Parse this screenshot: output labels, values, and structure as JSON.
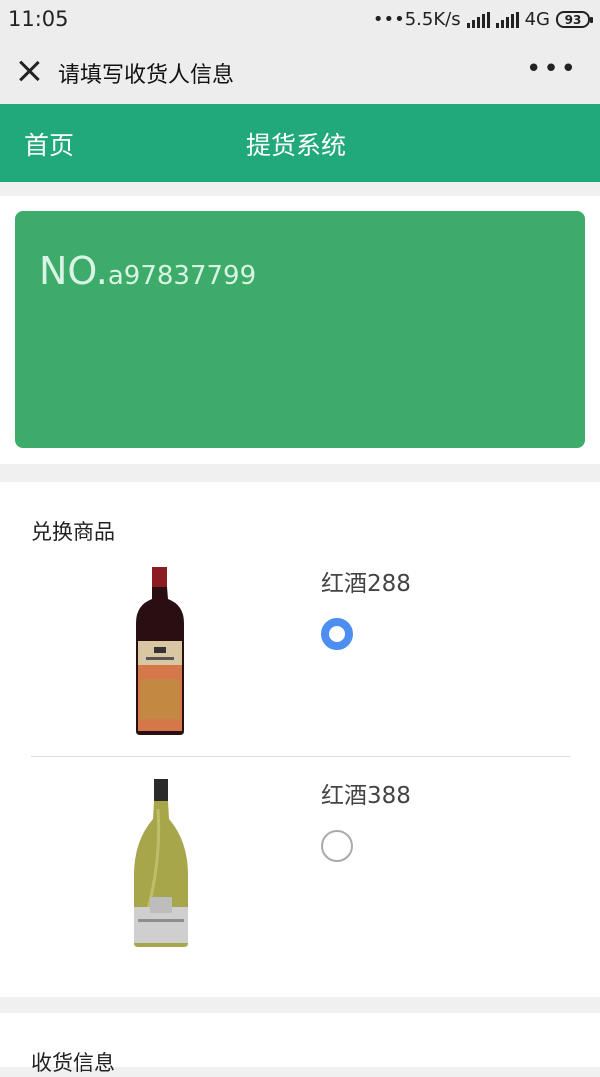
{
  "status_bar": {
    "time": "11:05",
    "network_speed": "•••5.5K/s",
    "network_type": "4G",
    "battery": "93"
  },
  "title_bar": {
    "close_icon": "close-icon",
    "title": "请填写收货人信息",
    "more_icon": "more-icon",
    "more_label": "•••"
  },
  "nav": {
    "home": "首页",
    "system": "提货系统"
  },
  "card": {
    "no_prefix": "NO.",
    "code": "a97837799",
    "color": "#3dab6a"
  },
  "products": {
    "section_title": "兑换商品",
    "items": [
      {
        "name": "红酒288",
        "selected": true,
        "image": "red-wine-bottle"
      },
      {
        "name": "红酒388",
        "selected": false,
        "image": "white-wine-bottle"
      }
    ]
  },
  "receiver": {
    "section_title": "收货信息"
  },
  "colors": {
    "nav_green": "#21a87b",
    "radio_blue": "#4c8ff0"
  }
}
